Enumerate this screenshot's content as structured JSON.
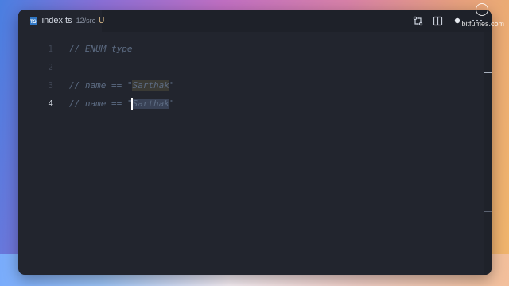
{
  "tab": {
    "icon": "TS",
    "filename": "index.ts",
    "path": "12/src",
    "status": "U"
  },
  "toolbar": {
    "actions": [
      "git-compare-icon",
      "split-editor-icon",
      "unsaved-dot-icon",
      "more-actions-icon"
    ]
  },
  "watermark": {
    "text": "bitfumes.com"
  },
  "editor": {
    "lines": [
      {
        "number": "1",
        "before": "// ENUM type",
        "highlight": "",
        "after": ""
      },
      {
        "number": "2",
        "before": "",
        "highlight": "",
        "after": ""
      },
      {
        "number": "3",
        "before": "// name == \"",
        "highlight": "Sarthak",
        "after": "\""
      },
      {
        "number": "4",
        "before": "// name == \"",
        "highlight": "Sarthak",
        "after": "\""
      }
    ],
    "active_line": "4"
  },
  "colors": {
    "editor_bg": "#22252e",
    "comment": "#5c6b82",
    "ts_blue": "#3178c6",
    "untracked": "#e2c08d"
  }
}
